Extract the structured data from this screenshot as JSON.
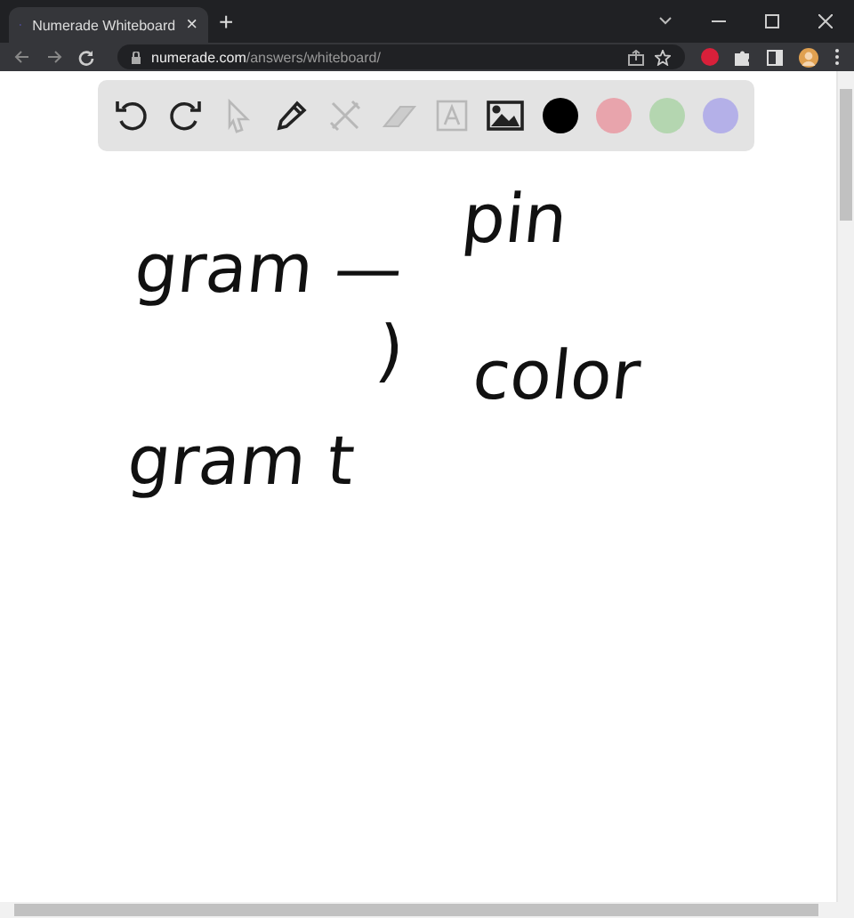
{
  "tab": {
    "title": "Numerade Whiteboard",
    "close": "×",
    "new_tab": "+"
  },
  "address_bar": {
    "domain": "numerade.com",
    "path": "/answers/whiteboard/"
  },
  "toolbar": {
    "tools": [
      {
        "kind": "undo",
        "disabled": false
      },
      {
        "kind": "redo",
        "disabled": false
      },
      {
        "kind": "select",
        "disabled": true
      },
      {
        "kind": "pen",
        "disabled": false
      },
      {
        "kind": "tools",
        "disabled": true
      },
      {
        "kind": "eraser",
        "disabled": true
      },
      {
        "kind": "text",
        "disabled": true
      },
      {
        "kind": "image",
        "disabled": false
      }
    ],
    "colors": [
      {
        "color": "#000000"
      },
      {
        "color": "#e8a4ac"
      },
      {
        "color": "#b4d6b0"
      },
      {
        "color": "#b4b0e8"
      }
    ]
  },
  "strokes": [
    {
      "text": "gram —"
    },
    {
      "text": "pin"
    },
    {
      "text": ")"
    },
    {
      "text": "color"
    },
    {
      "text": "gram t"
    }
  ]
}
